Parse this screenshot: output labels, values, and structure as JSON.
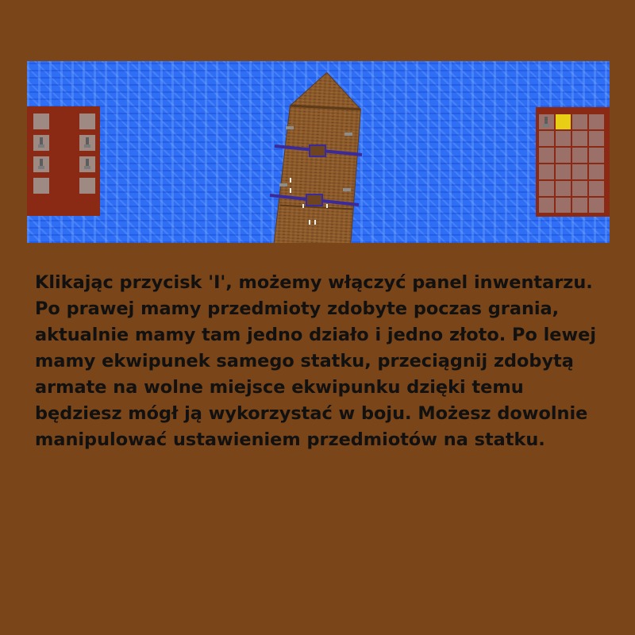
{
  "scene": {
    "water_color": "#2f6ff5",
    "ship_color": "#8b5a2b",
    "panel_color": "#8a2a15"
  },
  "equipment_panel": {
    "slots": [
      {
        "item": "empty"
      },
      {
        "item": "empty"
      },
      {
        "item": "cannon"
      },
      {
        "item": "cannon"
      },
      {
        "item": "cannon"
      },
      {
        "item": "cannon"
      },
      {
        "item": "empty"
      },
      {
        "item": "empty"
      }
    ]
  },
  "inventory_panel": {
    "rows": 6,
    "columns": 4,
    "items": [
      {
        "slot": 1,
        "item": "cannon"
      },
      {
        "slot": 2,
        "item": "gold",
        "color": "#e8cf16"
      }
    ]
  },
  "instructions": {
    "text": "Klikając przycisk 'I', możemy włączyć panel inwentarzu. Po prawej mamy przedmioty zdobyte poczas grania, aktualnie mamy tam jedno działo i jedno złoto. Po lewej mamy ekwipunek samego statku, przeciągnij zdobytą armate na wolne miejsce ekwipunku dzięki temu będziesz mógł ją wykorzystać w boju. Możesz dowolnie manipulować ustawieniem przedmiotów na statku."
  }
}
